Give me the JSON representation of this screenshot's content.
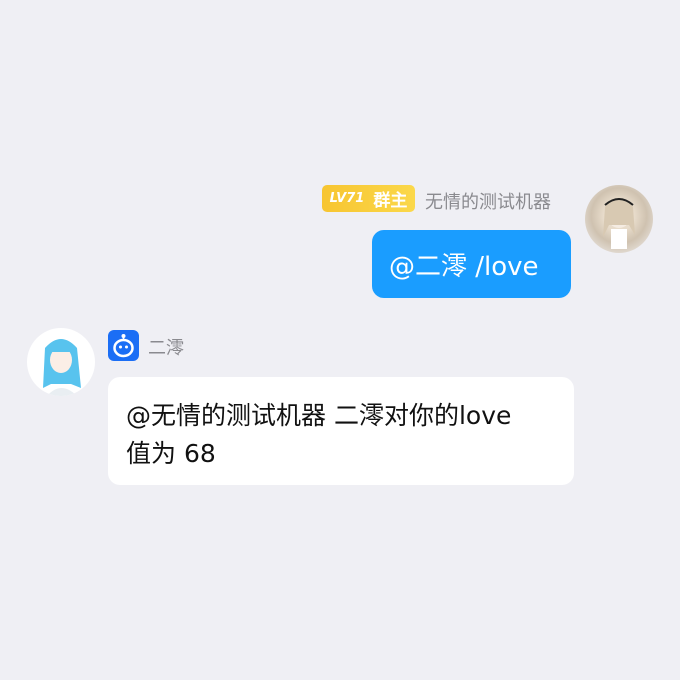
{
  "sender_message": {
    "level": "LV71",
    "role": "群主",
    "name": "无情的测试机器",
    "text": "@二澪 /love"
  },
  "bot_message": {
    "name": "二澪",
    "text": "@无情的测试机器 二澪对你的love值为 68"
  },
  "colors": {
    "background": "#efeff4",
    "outgoing_bubble": "#1a9dff",
    "badge": "#f7c531",
    "bot_icon": "#1b6ef5"
  }
}
